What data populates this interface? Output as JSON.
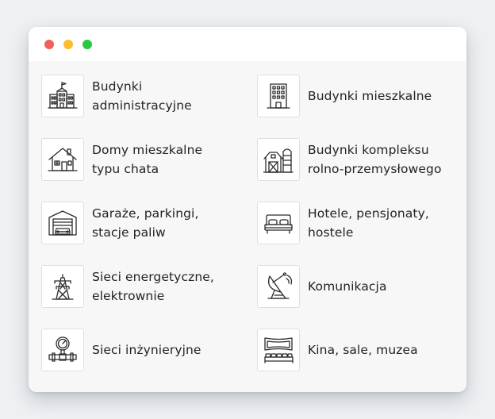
{
  "window": {
    "buttons": [
      {
        "name": "close",
        "color": "#f25f58"
      },
      {
        "name": "minimize",
        "color": "#fbbe2f"
      },
      {
        "name": "maximize",
        "color": "#28c840"
      }
    ]
  },
  "categories": {
    "left": [
      {
        "label": "Budynki\nadministracyjne",
        "icon": "administrative-building-icon"
      },
      {
        "label": "Domy mieszkalne\ntypu chata",
        "icon": "house-icon"
      },
      {
        "label": "Garaże, parkingi,\nstacje paliw",
        "icon": "garage-icon"
      },
      {
        "label": "Sieci energetyczne,\nelektrownie",
        "icon": "power-pylon-icon"
      },
      {
        "label": "Sieci inżynieryjne",
        "icon": "pipe-gauge-icon"
      }
    ],
    "right": [
      {
        "label": "Budynki mieszkalne",
        "icon": "apartment-building-icon"
      },
      {
        "label": "Budynki kompleksu\nrolno-przemysłowego",
        "icon": "barn-silo-icon"
      },
      {
        "label": "Hotele, pensjonaty,\nhostele",
        "icon": "bed-icon"
      },
      {
        "label": "Komunikacja",
        "icon": "satellite-dish-icon"
      },
      {
        "label": "Kina, sale, muzea",
        "icon": "cinema-hall-icon"
      }
    ]
  }
}
